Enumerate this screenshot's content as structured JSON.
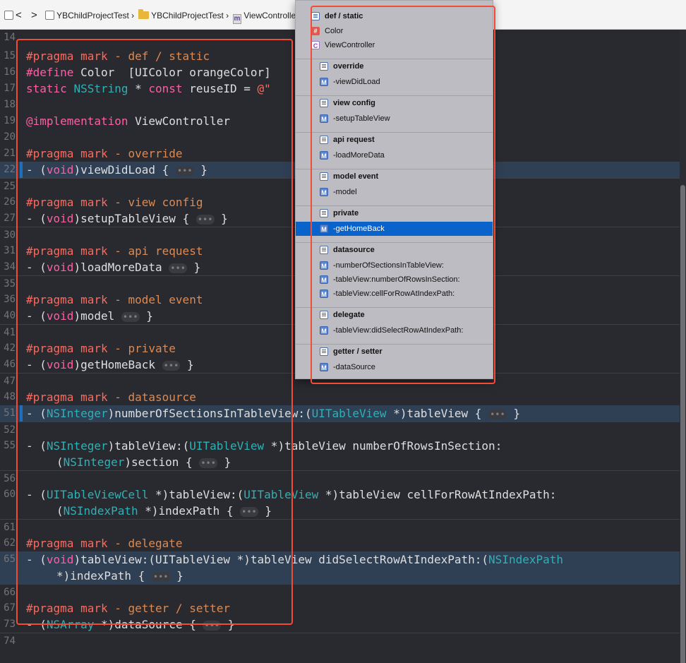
{
  "jumpbar": {
    "back_label": "<",
    "forward_label": ">",
    "crumbs": [
      "YBChildProjectTest",
      "YBChildProjectTest",
      "ViewControlle"
    ]
  },
  "editor": {
    "lines": {
      "l14": "14",
      "l15": "15",
      "l16": "16",
      "l17": "17",
      "l18": "18",
      "l19": "19",
      "l20": "20",
      "l21": "21",
      "l22": "22",
      "l25": "25",
      "l26": "26",
      "l27": "27",
      "l30": "30",
      "l31": "31",
      "l34": "34",
      "l35": "35",
      "l36": "36",
      "l40": "40",
      "l41": "41",
      "l42": "42",
      "l46": "46",
      "l47": "47",
      "l48": "48",
      "l51": "51",
      "l52": "52",
      "l55": "55",
      "l56": "56",
      "l60": "60",
      "l61": "61",
      "l62": "62",
      "l65": "65",
      "l66": "66",
      "l67": "67",
      "l73": "73",
      "l74": "74"
    },
    "code": {
      "pragma_def": "#pragma mark",
      "mark_def": " - def / static",
      "define_kw": "#define",
      "define_rest": " Color  [UIColor orangeColor]",
      "static_kw": "static",
      "static_type": "NSString",
      "static_mid": " * ",
      "const_kw": "const",
      "static_rest": " reuseID = ",
      "static_str": "@\"",
      "impl_kw": "@implementation",
      "impl_name": " ViewController",
      "pragma_override": "#pragma mark",
      "mark_override": " - override",
      "viewdidload_pre": "- (",
      "void_1": "void",
      "viewdidload_post": ")viewDidLoad { ",
      "fold_1": "•••",
      "close_1": " }",
      "pragma_viewconfig": "#pragma mark",
      "mark_viewconfig": " - view config",
      "setup_pre": "- (",
      "void_2": "void",
      "setup_post": ")setupTableView { ",
      "fold_2": "•••",
      "close_2": " }",
      "pragma_api": "#pragma mark",
      "mark_api": " - api request",
      "load_pre": "- (",
      "void_3": "void",
      "load_post": ")loadMoreData ",
      "fold_3": "•••",
      "close_3": " }",
      "pragma_model": "#pragma mark",
      "mark_model": " - model event",
      "model_pre": "- (",
      "void_4": "void",
      "model_post": ")model ",
      "fold_4": "•••",
      "close_4": " }",
      "pragma_private": "#pragma mark",
      "mark_private": " - private",
      "home_pre": "- (",
      "void_5": "void",
      "home_post": ")getHomeBack ",
      "fold_5": "•••",
      "close_5": " }",
      "pragma_ds": "#pragma mark",
      "mark_ds": " - datasource",
      "sections_pre": "- (",
      "nsint_1": "NSInteger",
      "sections_mid": ")numberOfSectionsInTableView:(",
      "uitv_1": "UITableView",
      "sections_post": " *)tableView { ",
      "fold_6": "•••",
      "close_6": " }",
      "rows_pre": "- (",
      "nsint_2": "NSInteger",
      "rows_mid": ")tableView:(",
      "uitv_2": "UITableView",
      "rows_post": " *)tableView numberOfRowsInSection:",
      "rows2_pre": "(",
      "nsint_3": "NSInteger",
      "rows2_post": ")section { ",
      "fold_7": "•••",
      "close_7": " }",
      "cell_pre": "- (",
      "uitvc": "UITableViewCell",
      "cell_mid": " *)tableView:(",
      "uitv_3": "UITableView",
      "cell_post": " *)tableView cellForRowAtIndexPath:",
      "cell2_pre": "(",
      "nsip_1": "NSIndexPath",
      "cell2_post": " *)indexPath { ",
      "fold_8": "•••",
      "close_8": " }",
      "pragma_delegate": "#pragma mark",
      "mark_delegate": " - delegate",
      "did_pre": "- (",
      "void_6": "void",
      "did_post": ")tableView:(UITableView *)tableView didSelectRowAtIndexPath:(",
      "nsip_2": "NSIndexPath",
      "did2": "*)indexPath { ",
      "fold_9": "•••",
      "close_9": " }",
      "pragma_gs": "#pragma mark",
      "mark_gs": " - getter / setter",
      "ds_pre": "- (",
      "nsarray": "NSArray",
      "ds_post": " *)dataSource { ",
      "fold_10": "•••",
      "close_10": " }"
    }
  },
  "dropdown": {
    "items": [
      {
        "label": "def / static",
        "icon": "mark-icon"
      },
      {
        "label": "Color",
        "icon": "macro-icon"
      },
      {
        "label": "ViewController",
        "icon": "class-icon"
      },
      {
        "label": "override",
        "icon": "mark-icon"
      },
      {
        "label": "-viewDidLoad",
        "icon": "method-icon"
      },
      {
        "label": "view config",
        "icon": "mark-icon"
      },
      {
        "label": "-setupTableView",
        "icon": "method-icon"
      },
      {
        "label": "api request",
        "icon": "mark-icon"
      },
      {
        "label": "-loadMoreData",
        "icon": "method-icon"
      },
      {
        "label": "model event",
        "icon": "mark-icon"
      },
      {
        "label": "-model",
        "icon": "method-icon"
      },
      {
        "label": "private",
        "icon": "mark-icon"
      },
      {
        "label": "-getHomeBack",
        "icon": "method-icon"
      },
      {
        "label": "datasource",
        "icon": "mark-icon"
      },
      {
        "label": "-numberOfSectionsInTableView:",
        "icon": "method-icon"
      },
      {
        "label": "-tableView:numberOfRowsInSection:",
        "icon": "method-icon"
      },
      {
        "label": "-tableView:cellForRowAtIndexPath:",
        "icon": "method-icon"
      },
      {
        "label": "delegate",
        "icon": "mark-icon"
      },
      {
        "label": "-tableView:didSelectRowAtIndexPath:",
        "icon": "method-icon"
      },
      {
        "label": "getter / setter",
        "icon": "mark-icon"
      },
      {
        "label": "-dataSource",
        "icon": "method-icon"
      }
    ],
    "icon_glyphs": {
      "macro": "#",
      "class": "C",
      "method": "M"
    }
  },
  "colors": {
    "editor_bg": "#292a30",
    "pragma": "#fc6a5d",
    "mark_text": "#dd8a52",
    "keyword": "#fc5fa3",
    "type": "#2eb1b5",
    "selection": "#0a63cb",
    "annotation_red": "#f24b36"
  }
}
